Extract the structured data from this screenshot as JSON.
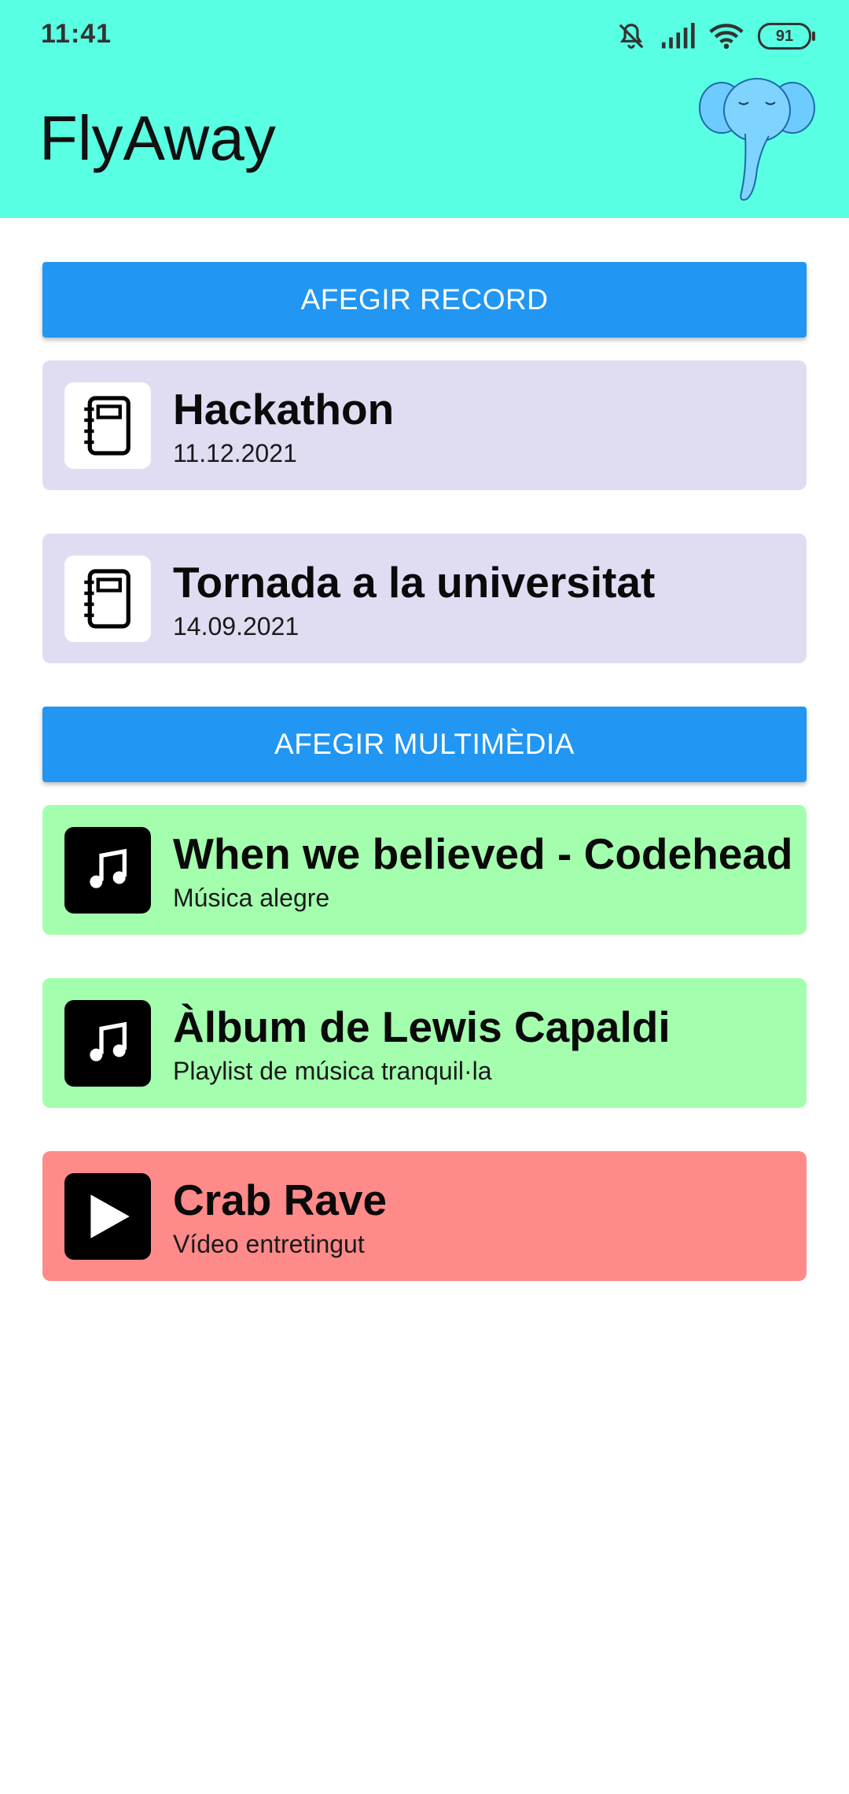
{
  "status_bar": {
    "time": "11:41",
    "battery": "91",
    "icons": [
      "mute-icon",
      "signal-icon",
      "wifi-icon",
      "battery-icon"
    ]
  },
  "app_bar": {
    "title": "FlyAway",
    "logo": "elephant-icon",
    "color": "#59ffe2"
  },
  "records": {
    "add_label": "AFEGIR RECORD",
    "items": [
      {
        "title": "Hackathon",
        "subtitle": "11.12.2021",
        "icon": "notebook-icon"
      },
      {
        "title": "Tornada a la universitat",
        "subtitle": "14.09.2021",
        "icon": "notebook-icon"
      }
    ],
    "card_color": "#e0ddf3"
  },
  "multimedia": {
    "add_label": "AFEGIR MULTIMÈDIA",
    "items": [
      {
        "title": "When we believed - Codehead",
        "subtitle": "Música alegre",
        "icon": "music-note-icon",
        "color": "#a3ffae"
      },
      {
        "title": "Àlbum de Lewis Capaldi",
        "subtitle": "Playlist de música tranquil·la",
        "icon": "music-note-icon",
        "color": "#a3ffae"
      },
      {
        "title": "Crab Rave",
        "subtitle": "Vídeo entretingut",
        "icon": "play-icon",
        "color": "#ff8a8a"
      }
    ]
  },
  "accent_color": "#2196f3"
}
